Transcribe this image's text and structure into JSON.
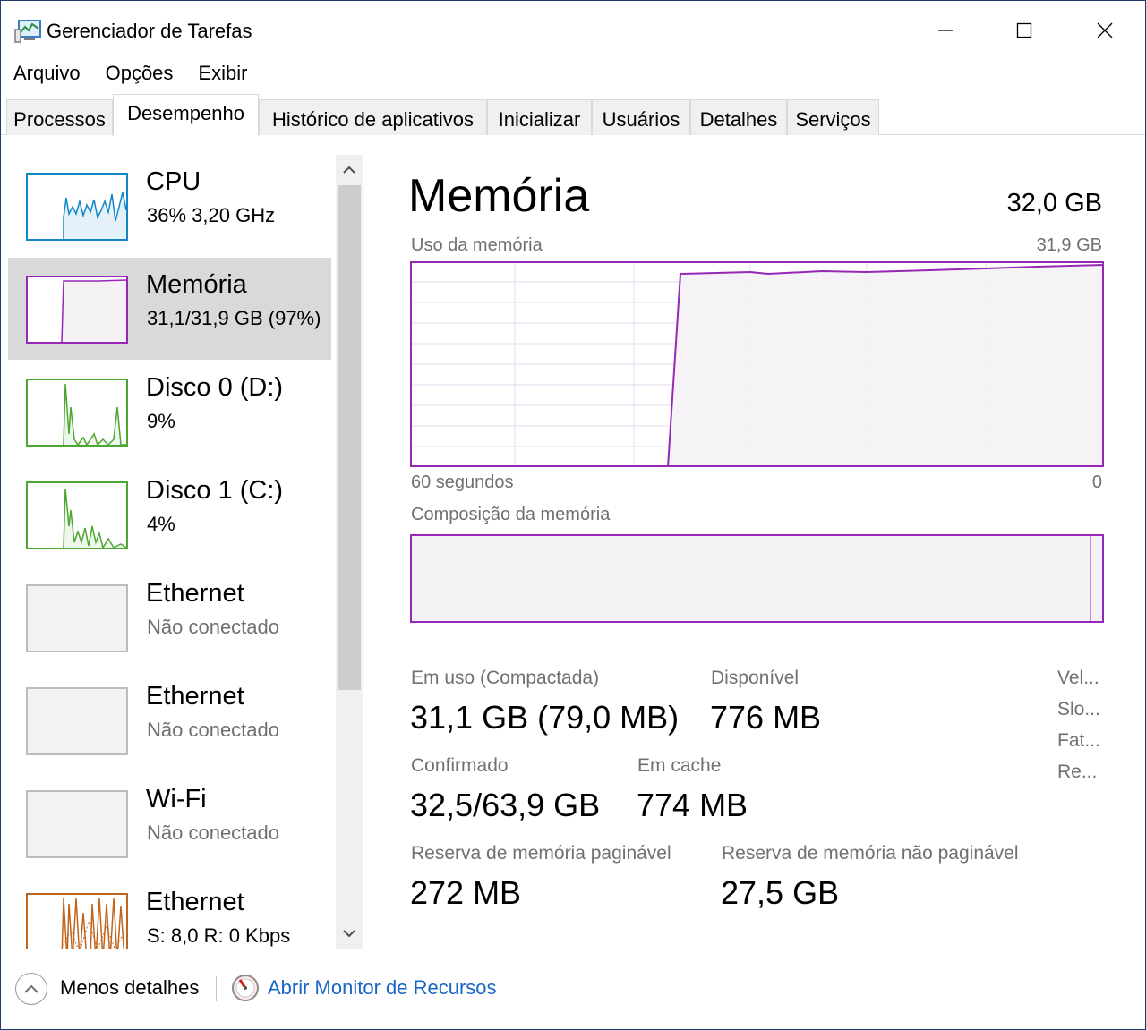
{
  "window": {
    "title": "Gerenciador de Tarefas"
  },
  "menu": [
    "Arquivo",
    "Opções",
    "Exibir"
  ],
  "tabs": [
    {
      "label": "Processos",
      "active": false
    },
    {
      "label": "Desempenho",
      "active": true
    },
    {
      "label": "Histórico de aplicativos",
      "active": false
    },
    {
      "label": "Inicializar",
      "active": false
    },
    {
      "label": "Usuários",
      "active": false
    },
    {
      "label": "Detalhes",
      "active": false
    },
    {
      "label": "Serviços",
      "active": false
    }
  ],
  "sidebar": {
    "items": [
      {
        "title": "CPU",
        "subtitle": "36%  3,20 GHz",
        "color": "#1187c8",
        "selected": false,
        "graph": "cpu-graph"
      },
      {
        "title": "Memória",
        "subtitle": "31,1/31,9 GB (97%)",
        "color": "#9528b4",
        "selected": true,
        "graph": "memory-graph"
      },
      {
        "title": "Disco 0 (D:)",
        "subtitle": "9%",
        "color": "#4da631",
        "selected": false,
        "graph": "disk-graph"
      },
      {
        "title": "Disco 1 (C:)",
        "subtitle": "4%",
        "color": "#4da631",
        "selected": false,
        "graph": "disk-graph"
      },
      {
        "title": "Ethernet",
        "subtitle": "Não conectado",
        "color": "#bcbcbc",
        "selected": false,
        "graph": "empty"
      },
      {
        "title": "Ethernet",
        "subtitle": "Não conectado",
        "color": "#bcbcbc",
        "selected": false,
        "graph": "empty"
      },
      {
        "title": "Wi-Fi",
        "subtitle": "Não conectado",
        "color": "#bcbcbc",
        "selected": false,
        "graph": "empty"
      },
      {
        "title": "Ethernet",
        "subtitle": "S: 8,0  R: 0 Kbps",
        "color": "#c0651e",
        "selected": false,
        "graph": "network-graph"
      }
    ]
  },
  "main": {
    "title": "Memória",
    "total": "32,0 GB",
    "usage_label": "Uso da memória",
    "usage_max": "31,9 GB",
    "time_left": "60 segundos",
    "time_right": "0",
    "composition_label": "Composição da memória",
    "stats": {
      "in_use_label": "Em uso (Compactada)",
      "in_use_value": "31,1 GB (79,0 MB)",
      "available_label": "Disponível",
      "available_value": "776 MB",
      "committed_label": "Confirmado",
      "committed_value": "32,5/63,9 GB",
      "cached_label": "Em cache",
      "cached_value": "774 MB",
      "paged_label": "Reserva de memória paginável",
      "paged_value": "272 MB",
      "nonpaged_label": "Reserva de memória não paginável",
      "nonpaged_value": "27,5 GB"
    },
    "right_labels": [
      "Vel...",
      "Slo...",
      "Fat...",
      "Re..."
    ],
    "accent": "#9528b4"
  },
  "footer": {
    "less_details": "Menos detalhes",
    "resource_monitor": "Abrir Monitor de Recursos"
  }
}
